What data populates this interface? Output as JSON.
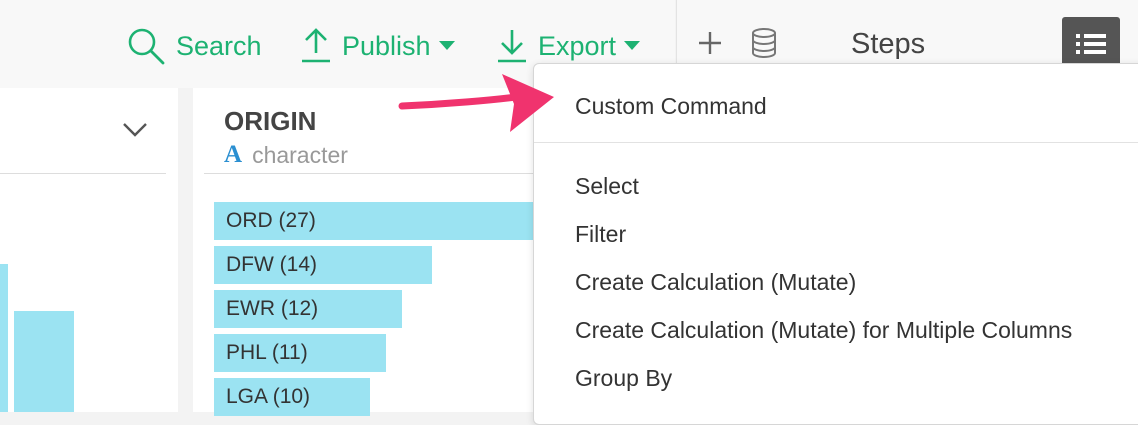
{
  "toolbar": {
    "search_label": "Search",
    "publish_label": "Publish",
    "export_label": "Export"
  },
  "steps_panel": {
    "title": "Steps"
  },
  "column": {
    "name": "ORIGIN",
    "type_icon": "A",
    "type_label": "character",
    "bars": [
      {
        "label": "ORD (27)",
        "count": 27
      },
      {
        "label": "DFW (14)",
        "count": 14
      },
      {
        "label": "EWR (12)",
        "count": 12
      },
      {
        "label": "PHL (11)",
        "count": 11
      },
      {
        "label": "LGA (10)",
        "count": 10
      }
    ]
  },
  "menu": {
    "items": [
      "Custom Command",
      "Select",
      "Filter",
      "Create Calculation (Mutate)",
      "Create Calculation (Mutate) for Multiple Columns",
      "Group By"
    ]
  },
  "colors": {
    "accent": "#1db272",
    "bar": "#9be3f2",
    "type_icon": "#2b8fd1",
    "arrow": "#f0336e"
  }
}
